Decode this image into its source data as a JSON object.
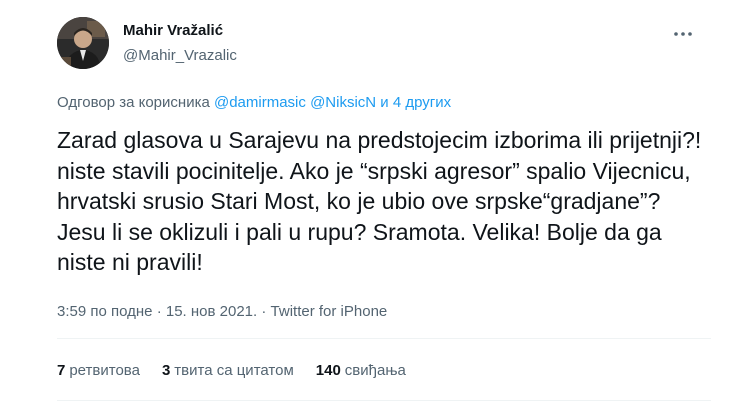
{
  "author": {
    "name": "Mahir Vražalić",
    "handle": "@Mahir_Vrazalic"
  },
  "reply_context": {
    "prefix": "Одговор за корисника",
    "mentions": [
      "@damirmasic",
      "@NiksicN"
    ],
    "others": "и 4 других"
  },
  "tweet_text": "Zarad glasova u Sarajevu na predstojecim izborima ili prijetnji?! niste stavili pocinitelje. Ako je “srpski agresor” spalio Vijecnicu, hrvatski srusio Stari Most, ko je ubio ove srpske“gradjane”? Jesu li se oklizuli i pali u rupu? Sramota. Velika! Bolje da ga niste ni pravili!",
  "meta": {
    "time": "3:59 по подне",
    "separator": "·",
    "date": "15. нов 2021.",
    "source": "Twitter for iPhone"
  },
  "stats": {
    "retweets_count": "7",
    "retweets_label": "ретвитова",
    "quotes_count": "3",
    "quotes_label": "твита са цитатом",
    "likes_count": "140",
    "likes_label": "свиђања"
  },
  "colors": {
    "text": "#0f1419",
    "secondary": "#536471",
    "link": "#1d9bf0",
    "divider": "#eff3f4"
  },
  "icons": {
    "more": "more-horizontal-icon"
  }
}
